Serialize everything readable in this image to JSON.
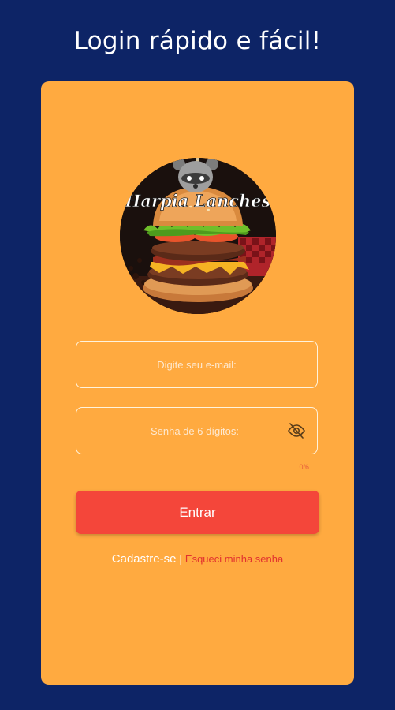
{
  "header": {
    "title": "Login rápido e fácil!"
  },
  "logo": {
    "brand_text": "Harpia Lanches"
  },
  "form": {
    "email_placeholder": "Digite seu e-mail:",
    "email_value": "",
    "password_placeholder": "Senha de 6 dígitos:",
    "password_value": "",
    "password_counter": "0/6",
    "toggle_icon": "eye-off-icon"
  },
  "actions": {
    "enter_label": "Entrar",
    "register_label": "Cadastre-se",
    "separator": " | ",
    "forgot_label": "Esqueci minha senha"
  },
  "colors": {
    "background": "#0d2466",
    "card": "#ffaa40",
    "primary_button": "#f4463a",
    "forgot_link": "#e2312f"
  }
}
